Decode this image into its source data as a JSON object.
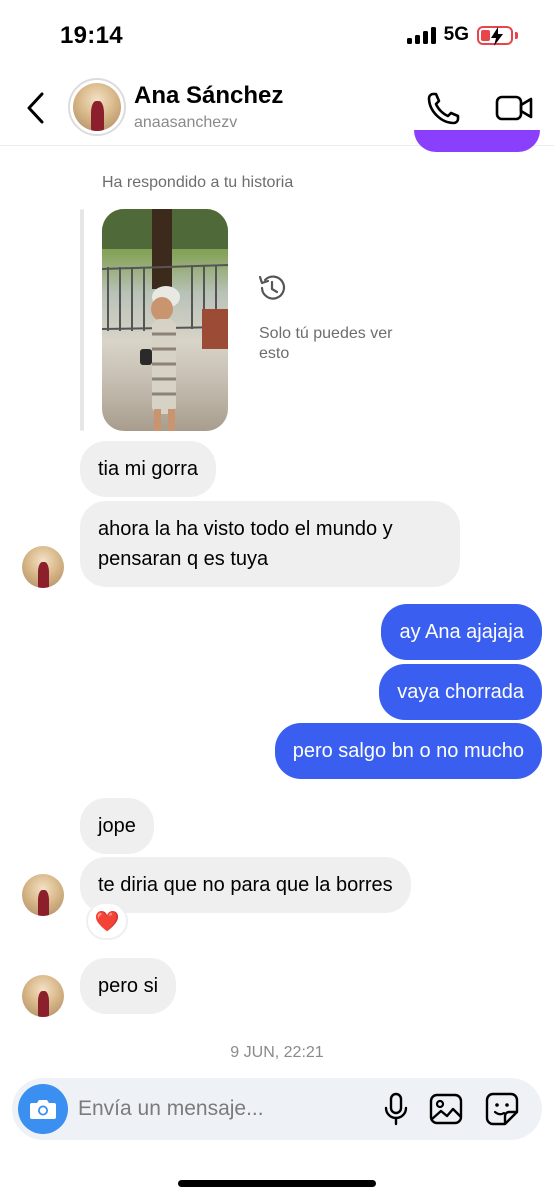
{
  "status_bar": {
    "time": "19:14",
    "network": "5G"
  },
  "header": {
    "name": "Ana Sánchez",
    "username": "anaasanchezv"
  },
  "story_reply": {
    "caption": "Ha respondido a tu historia",
    "note": "Solo tú puedes ver esto"
  },
  "messages": [
    {
      "from": "them",
      "text": "tia mi gorra"
    },
    {
      "from": "them",
      "text": "ahora la ha visto todo el mundo y pensaran q es tuya"
    },
    {
      "from": "me",
      "text": "ay Ana ajajaja"
    },
    {
      "from": "me",
      "text": "vaya chorrada"
    },
    {
      "from": "me",
      "text": "pero salgo bn o no mucho"
    },
    {
      "from": "them",
      "text": "jope"
    },
    {
      "from": "them",
      "text": "te diria que no para que la borres"
    },
    {
      "from": "them",
      "text": "pero si"
    }
  ],
  "reaction": "❤️",
  "timestamp": "9 JUN, 22:21",
  "composer": {
    "placeholder": "Envía un mensaje..."
  },
  "colors": {
    "outgoing_bubble": "#3a5ff0",
    "incoming_bubble": "#efefef",
    "camera_button": "#3a8ff0",
    "accent_purple": "#8a3ffc"
  }
}
